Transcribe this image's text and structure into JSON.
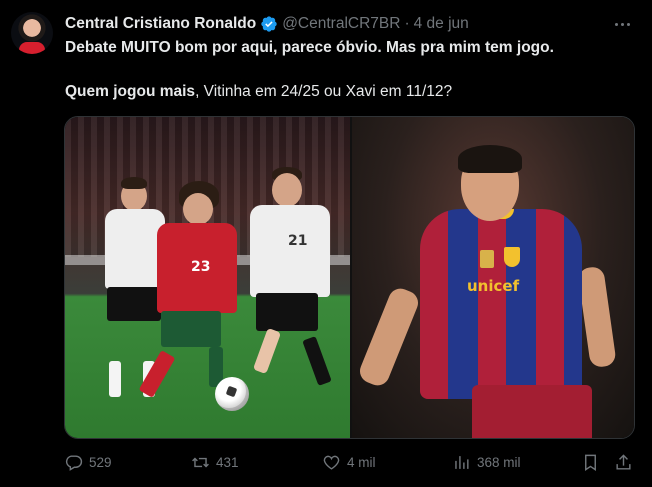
{
  "author": {
    "display_name": "Central Cristiano Ronaldo",
    "handle": "@CentralCR7BR",
    "separator": "·",
    "date": "4 de jun",
    "verified": true
  },
  "tweet": {
    "line1": "Debate MUITO bom por aqui, parece óbvio. Mas pra mim tem jogo.",
    "line2_bold": "Quem jogou mais",
    "line2_rest": ", Vitinha em 24/25 ou Xavi em 11/12?"
  },
  "media": {
    "left_photo": {
      "jersey_number": "23"
    },
    "right_photo": {
      "sponsor": "unicef"
    }
  },
  "actions": {
    "replies": "529",
    "retweets": "431",
    "likes": "4 mil",
    "views": "368 mil"
  },
  "colors": {
    "background": "#000000",
    "text_primary": "#e7e9ea",
    "text_secondary": "#71767b",
    "verified_blue": "#1d9bf0"
  },
  "icons": [
    "more-icon",
    "verified-icon",
    "reply-icon",
    "retweet-icon",
    "like-icon",
    "views-icon",
    "bookmark-icon",
    "share-icon"
  ]
}
